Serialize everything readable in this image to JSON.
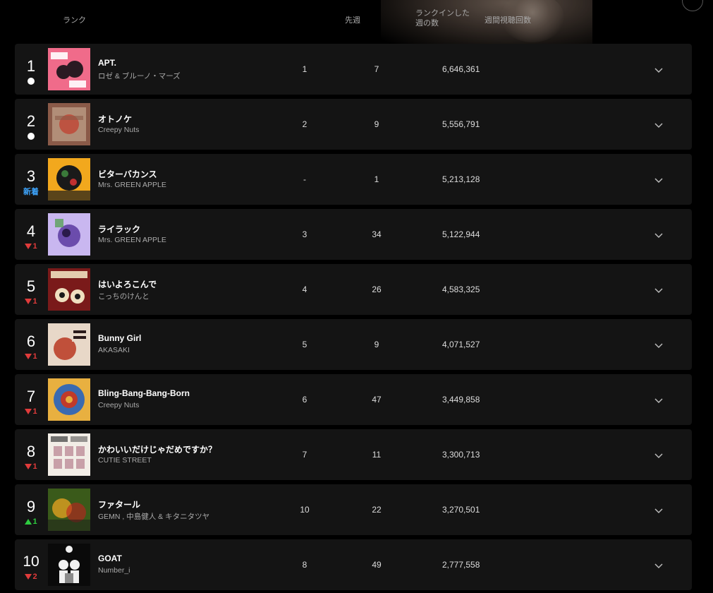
{
  "header": {
    "rank_label": "ランク",
    "last_week_label": "先週",
    "weeks_label_line1": "ランクインした",
    "weeks_label_line2": "週の数",
    "views_label": "週間視聴回数"
  },
  "colors": {
    "background": "#000000",
    "row": "#141414",
    "new": "#3ea6ff",
    "down": "#e03b3b",
    "up": "#2ecc40"
  },
  "rows": [
    {
      "rank": "1",
      "change_type": "same",
      "change_value": "",
      "title": "APT.",
      "artist": "ロゼ & ブルーノ・マーズ",
      "last_week": "1",
      "weeks": "7",
      "views": "6,646,361"
    },
    {
      "rank": "2",
      "change_type": "same",
      "change_value": "",
      "title": "オトノケ",
      "artist": "Creepy Nuts",
      "last_week": "2",
      "weeks": "9",
      "views": "5,556,791"
    },
    {
      "rank": "3",
      "change_type": "new",
      "change_value": "新着",
      "title": "ビターバカンス",
      "artist": "Mrs. GREEN APPLE",
      "last_week": "-",
      "weeks": "1",
      "views": "5,213,128"
    },
    {
      "rank": "4",
      "change_type": "down",
      "change_value": "1",
      "title": "ライラック",
      "artist": "Mrs. GREEN APPLE",
      "last_week": "3",
      "weeks": "34",
      "views": "5,122,944"
    },
    {
      "rank": "5",
      "change_type": "down",
      "change_value": "1",
      "title": "はいよろこんで",
      "artist": "こっちのけんと",
      "last_week": "4",
      "weeks": "26",
      "views": "4,583,325"
    },
    {
      "rank": "6",
      "change_type": "down",
      "change_value": "1",
      "title": "Bunny Girl",
      "artist": "AKASAKI",
      "last_week": "5",
      "weeks": "9",
      "views": "4,071,527"
    },
    {
      "rank": "7",
      "change_type": "down",
      "change_value": "1",
      "title": "Bling-Bang-Bang-Born",
      "artist": "Creepy Nuts",
      "last_week": "6",
      "weeks": "47",
      "views": "3,449,858"
    },
    {
      "rank": "8",
      "change_type": "down",
      "change_value": "1",
      "title": "かわいいだけじゃだめですか？",
      "artist": "CUTIE STREET",
      "last_week": "7",
      "weeks": "11",
      "views": "3,300,713"
    },
    {
      "rank": "9",
      "change_type": "up",
      "change_value": "1",
      "title": "ファタール",
      "artist": "GEMN , 中島健人 & キタニタツヤ",
      "last_week": "10",
      "weeks": "22",
      "views": "3,270,501"
    },
    {
      "rank": "10",
      "change_type": "down",
      "change_value": "2",
      "title": "GOAT",
      "artist": "Number_i",
      "last_week": "8",
      "weeks": "49",
      "views": "2,777,558"
    }
  ],
  "thumbs": [
    {
      "icon": "album-art-apt",
      "bg": "#f06b8a",
      "fg": "#2a1a22",
      "accent": "#ffffff"
    },
    {
      "icon": "album-art-otonoke",
      "bg": "#8a5a48",
      "fg": "#d8c2a8",
      "accent": "#c23a2a"
    },
    {
      "icon": "album-art-bitter-vacance",
      "bg": "#f2a81d",
      "fg": "#1a1a1a",
      "accent": "#3a7a3a"
    },
    {
      "icon": "album-art-lilac",
      "bg": "#c9b7f0",
      "fg": "#5a3aa0",
      "accent": "#2a1a4a"
    },
    {
      "icon": "album-art-haiyorokonde",
      "bg": "#7a1a1a",
      "fg": "#f0e0c0",
      "accent": "#1a1a1a"
    },
    {
      "icon": "album-art-bunny-girl",
      "bg": "#e8d8c8",
      "fg": "#c0503a",
      "accent": "#2a1a1a"
    },
    {
      "icon": "album-art-bling-bang",
      "bg": "#e8b040",
      "fg": "#3a6ab0",
      "accent": "#c03a2a"
    },
    {
      "icon": "album-art-kawaii",
      "bg": "#f2ede6",
      "fg": "#c8a0a8",
      "accent": "#3a3a3a"
    },
    {
      "icon": "album-art-fatal",
      "bg": "#3a5a1a",
      "fg": "#e0a020",
      "accent": "#c02020"
    },
    {
      "icon": "album-art-goat",
      "bg": "#0a0a0a",
      "fg": "#f0f0f0",
      "accent": "#8a8a8a"
    }
  ]
}
